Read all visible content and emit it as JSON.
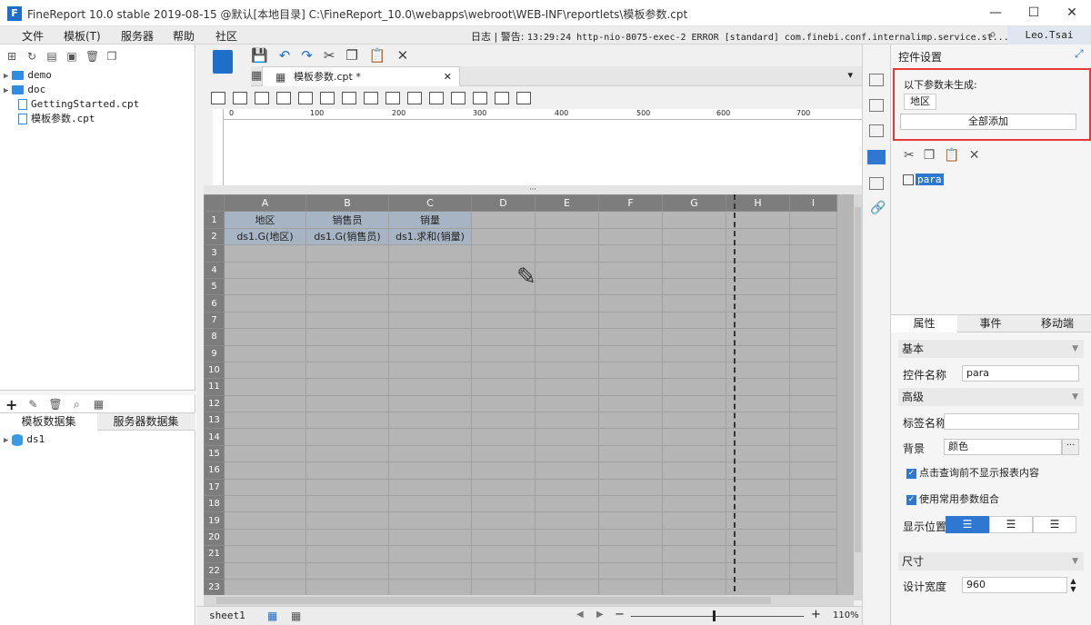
{
  "window": {
    "title": "FineReport 10.0 stable 2019-08-15 @默认[本地目录]   C:\\FineReport_10.0\\webapps\\webroot\\WEB-INF\\reportlets\\模板参数.cpt",
    "logo": "F",
    "minimize": "—",
    "maximize": "☐",
    "close": "✕"
  },
  "menu": {
    "items": [
      "文件",
      "模板(T)",
      "服务器",
      "帮助",
      "社区"
    ],
    "log_label": "日志",
    "alert_label": "警告:",
    "alert_text": "13:29:24 http-nio-8075-exec-2 ERROR [standard] com.finebi.conf.internalimp.service.st...",
    "user": "Leo.Tsai"
  },
  "tree": {
    "items": [
      {
        "label": "demo",
        "type": "folder"
      },
      {
        "label": "doc",
        "type": "folder"
      },
      {
        "label": "GettingStarted.cpt",
        "type": "file"
      },
      {
        "label": "模板参数.cpt",
        "type": "file"
      }
    ]
  },
  "datasets": {
    "tabs": [
      "模板数据集",
      "服务器数据集"
    ],
    "items": [
      "ds1"
    ]
  },
  "editor": {
    "tab_label": "模板参数.cpt *",
    "ruler_ticks": [
      "0",
      "100",
      "200",
      "300",
      "400",
      "500",
      "600",
      "700"
    ],
    "columns": [
      "A",
      "B",
      "C",
      "D",
      "E",
      "F",
      "G",
      "H",
      "I"
    ],
    "row1": [
      "地区",
      "销售员",
      "销量"
    ],
    "row2": [
      "ds1.G(地区)",
      "ds1.G(销售员)",
      "ds1.求和(销量)"
    ],
    "row_count": 23,
    "sheet": "sheet1",
    "zoom": "110%"
  },
  "panel": {
    "title": "控件设置",
    "notice": "以下参数未生成:",
    "param_chip": "地区",
    "add_all": "全部添加",
    "widget": "para",
    "tabs": [
      "属性",
      "事件",
      "移动端"
    ],
    "sec_basic": "基本",
    "name_label": "控件名称",
    "name_value": "para",
    "sec_advanced": "高级",
    "tag_label": "标签名称",
    "tag_value": "",
    "bg_label": "背景",
    "bg_value": "颜色",
    "chk1": "点击查询前不显示报表内容",
    "chk2": "使用常用参数组合",
    "pos_label": "显示位置",
    "sec_size": "尺寸",
    "width_label": "设计宽度",
    "width_value": "960"
  },
  "colors": {
    "accent": "#1f6ec9",
    "highlight_box": "#e53a3a",
    "grid_bg": "#b5b5b5"
  }
}
